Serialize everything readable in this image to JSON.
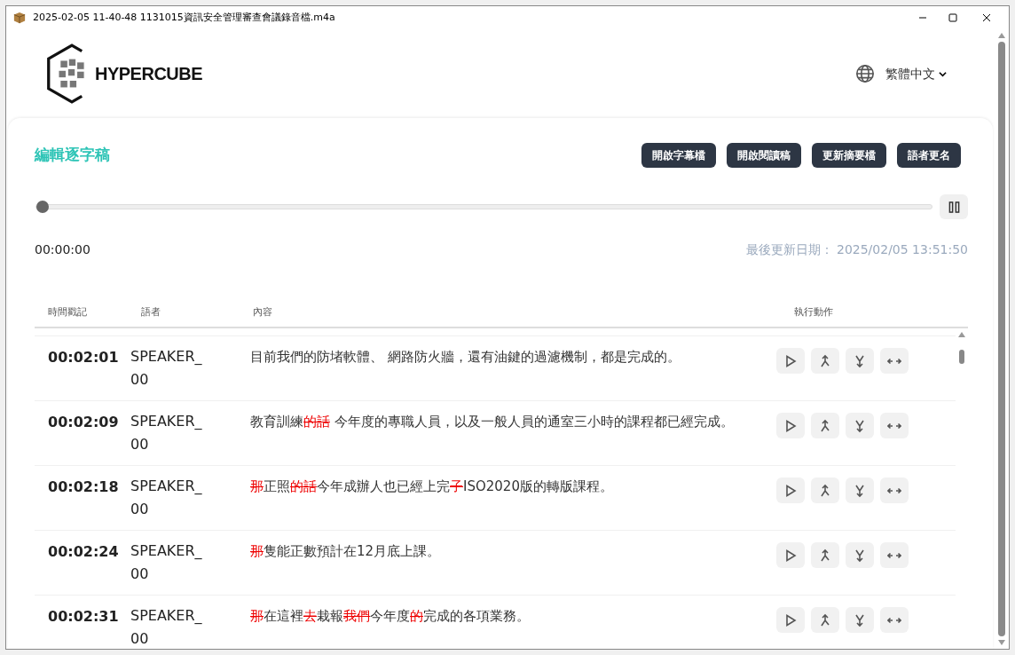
{
  "window": {
    "title": "2025-02-05 11-40-48 1131015資訊安全管理審查會議錄音檔.m4a"
  },
  "header": {
    "logo_text": "HYPERCUBE",
    "language": "繁體中文"
  },
  "editor": {
    "title": "編輯逐字稿",
    "buttons": [
      "開啟字幕檔",
      "開啟閱讀稿",
      "更新摘要檔",
      "語者更名"
    ],
    "player": {
      "level": 0,
      "time": "00:00:00"
    },
    "last_updated": "最後更新日期： 2025/02/05 13:51:50"
  },
  "table": {
    "columns": [
      "時間戳記",
      "語者",
      "內容",
      "執行動作"
    ],
    "rows": [
      {
        "time": "00:02:01",
        "speaker": "SPEAKER_00",
        "content": [
          {
            "text": "目前我們的防堵軟體、 網路防火牆，還有油鍵的過濾機制，都是完成的。",
            "deleted": false
          }
        ]
      },
      {
        "time": "00:02:09",
        "speaker": "SPEAKER_00",
        "content": [
          {
            "text": "教育訓練",
            "deleted": false
          },
          {
            "text": "的話",
            "deleted": true
          },
          {
            "text": " 今年度的專職人員，以及一般人員的通室三小時的課程都已經完成。",
            "deleted": false
          }
        ]
      },
      {
        "time": "00:02:18",
        "speaker": "SPEAKER_00",
        "content": [
          {
            "text": "那",
            "deleted": true
          },
          {
            "text": "正照",
            "deleted": false
          },
          {
            "text": "的話",
            "deleted": true
          },
          {
            "text": "今年成辦人也已經上完",
            "deleted": false
          },
          {
            "text": "子",
            "deleted": true
          },
          {
            "text": "ISO2020版的轉版課程。",
            "deleted": false
          }
        ]
      },
      {
        "time": "00:02:24",
        "speaker": "SPEAKER_00",
        "content": [
          {
            "text": "那",
            "deleted": true
          },
          {
            "text": "隻能正數預計在12月底上課。",
            "deleted": false
          }
        ]
      },
      {
        "time": "00:02:31",
        "speaker": "SPEAKER_00",
        "content": [
          {
            "text": "那",
            "deleted": true
          },
          {
            "text": "在這裡",
            "deleted": false
          },
          {
            "text": "去",
            "deleted": true
          },
          {
            "text": "栽報",
            "deleted": false
          },
          {
            "text": "我們",
            "deleted": true
          },
          {
            "text": "今年度",
            "deleted": false
          },
          {
            "text": "的",
            "deleted": true
          },
          {
            "text": "完成的各項業務。",
            "deleted": false
          }
        ]
      }
    ]
  }
}
